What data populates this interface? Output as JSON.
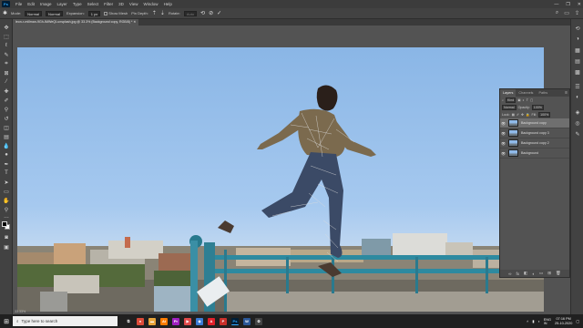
{
  "menubar": {
    "logo": "Ps",
    "items": [
      "File",
      "Edit",
      "Image",
      "Layer",
      "Type",
      "Select",
      "Filter",
      "3D",
      "View",
      "Window",
      "Help"
    ]
  },
  "options": {
    "mode_label": "Mode:",
    "mode_value": "Normal",
    "angle_value": "Normal",
    "expansion_label": "Expansion:",
    "expansion_value": "1 px",
    "show_mesh_label": "Show Mesh",
    "pin_depth_label": "Pin Depth:",
    "rotate_label": "Rotate:",
    "rotate_value": "Auto"
  },
  "document": {
    "tab_title": "leon-r-millman-9Gh-IMWeQI-unsplash.jpg @ 33.3% (Background copy, RGB/8) *",
    "status": "33.33%"
  },
  "layers_panel": {
    "tabs": [
      "Layers",
      "Channels",
      "Paths"
    ],
    "kind_label": "Kind",
    "blend_mode": "Normal",
    "opacity_label": "Opacity:",
    "opacity_value": "100%",
    "lock_label": "Lock:",
    "fill_label": "Fill:",
    "fill_value": "100%",
    "layers": [
      {
        "name": "Background copy",
        "selected": true
      },
      {
        "name": "Background copy 3",
        "selected": false
      },
      {
        "name": "Background copy 2",
        "selected": false
      },
      {
        "name": "Background",
        "selected": false
      }
    ]
  },
  "taskbar": {
    "search_placeholder": "Type here to search",
    "time": "07:16 PM",
    "date": "25-10-2020",
    "lang": "ENG",
    "lang_region": "IN"
  },
  "colors": {
    "sky": "#9dc2ea",
    "chrome": "#535353",
    "accent": "#31a8ff"
  }
}
